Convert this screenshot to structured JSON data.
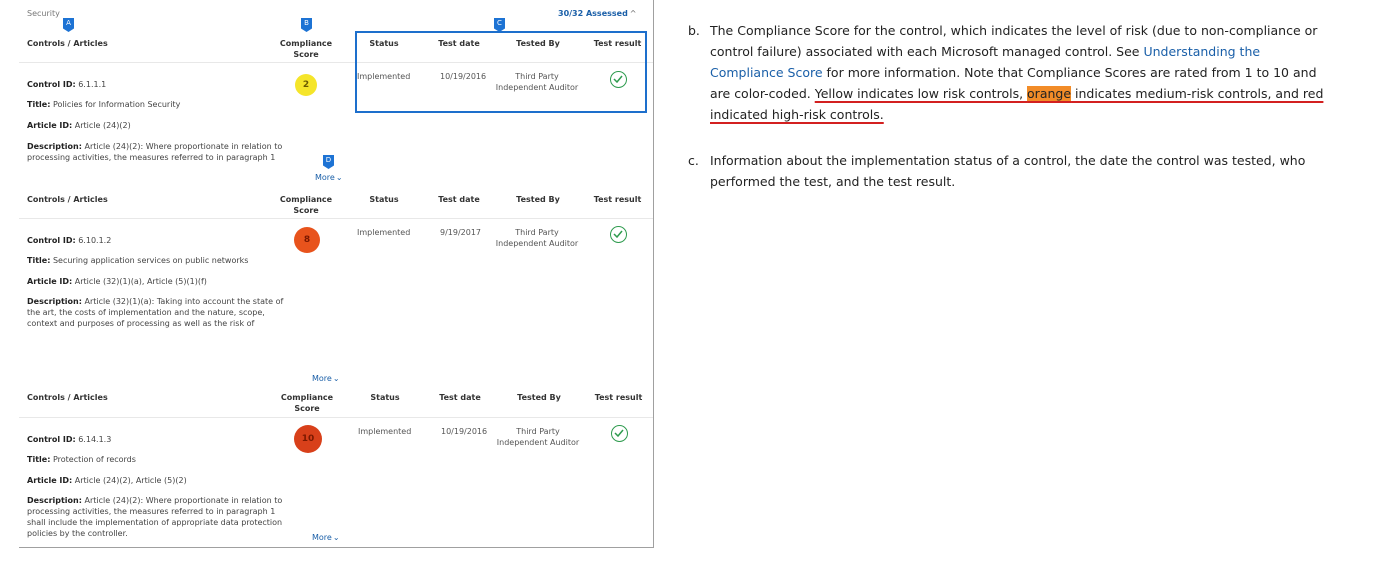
{
  "panel": {
    "section_title": "Security",
    "assessed": "30/32 Assessed",
    "markers": [
      "A",
      "B",
      "C",
      "D"
    ],
    "headers": {
      "controls": "Controls / Articles",
      "score": "Compliance Score",
      "status": "Status",
      "test_date": "Test date",
      "tested_by": "Tested By",
      "test_result": "Test result"
    },
    "more_label": "More",
    "controls": [
      {
        "control_id_label": "Control ID:",
        "control_id": "6.1.1.1",
        "title_label": "Title:",
        "title": "Policies for Information Security",
        "article_label": "Article ID:",
        "article": "Article (24)(2)",
        "desc_label": "Description:",
        "desc": "Article (24)(2): Where proportionate in relation to processing activities, the measures referred to in paragraph 1",
        "score": "2",
        "score_color": "#f5e52a",
        "status": "Implemented",
        "test_date": "10/19/2016",
        "tested_by": "Third Party Independent Auditor"
      },
      {
        "control_id_label": "Control ID:",
        "control_id": "6.10.1.2",
        "title_label": "Title:",
        "title": "Securing application services on public networks",
        "article_label": "Article ID:",
        "article": "Article (32)(1)(a), Article (5)(1)(f)",
        "desc_label": "Description:",
        "desc": "Article (32)(1)(a): Taking into account the state of the art, the costs of implementation and the nature, scope, context and purposes of processing as well as the risk of",
        "score": "8",
        "score_color": "#e8531c",
        "status": "Implemented",
        "test_date": "9/19/2017",
        "tested_by": "Third Party Independent Auditor"
      },
      {
        "control_id_label": "Control ID:",
        "control_id": "6.14.1.3",
        "title_label": "Title:",
        "title": "Protection of records",
        "article_label": "Article ID:",
        "article": "Article (24)(2), Article (5)(2)",
        "desc_label": "Description:",
        "desc": "Article (24)(2): Where proportionate in relation to processing activities, the measures referred to in paragraph 1 shall include the implementation of appropriate data protection policies by the controller.",
        "score": "10",
        "score_color": "#d8401a",
        "status": "Implemented",
        "test_date": "10/19/2016",
        "tested_by": "Third Party Independent Auditor"
      }
    ]
  },
  "notes": {
    "b_label": "b.",
    "b_text1": "The Compliance Score for the control, which indicates the level of risk (due to non-compliance or control failure) associated with each Microsoft managed control. See ",
    "b_link": "Understanding the Compliance Score",
    "b_text2": " for more information. Note that Compliance Scores are rated from 1 to 10 and are color-coded. ",
    "b_ul1": "Yellow indicates low risk controls, ",
    "b_orange": "orange",
    "b_ul2": " indicates medium-risk controls, and red indicated high-risk controls.",
    "c_label": "c.",
    "c_text": "Information about the implementation status of a control, the date the control was tested, who performed the test, and the test result."
  },
  "colors": {
    "accent": "#1d73d4",
    "link": "#1a5fa8",
    "check": "#2e9b4e",
    "underline": "#d32020",
    "highlight": "#f28c28"
  }
}
